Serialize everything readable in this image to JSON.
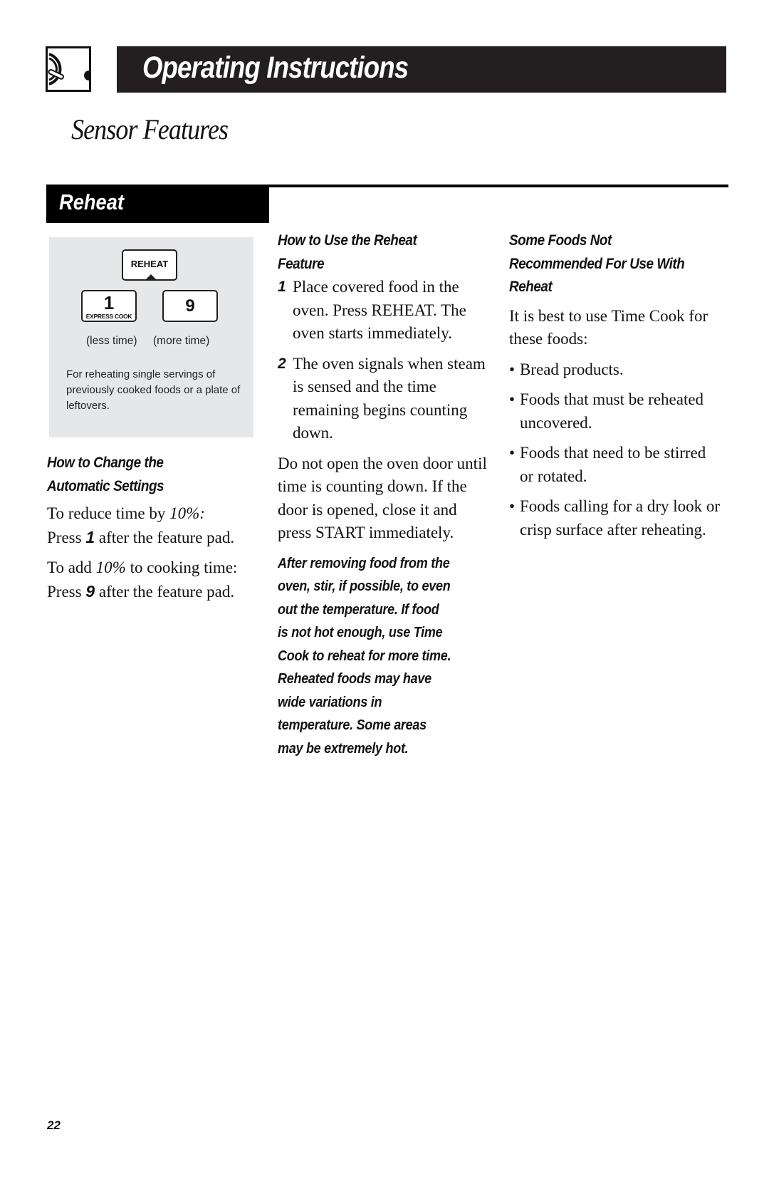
{
  "header": {
    "icon": "microwave-dial-icon",
    "title": "Operating Instructions"
  },
  "section_title": "Sensor Features",
  "subsection": {
    "title": "Reheat"
  },
  "panel": {
    "pads": {
      "reheat": "REHEAT",
      "one_number": "1",
      "one_sub": "EXPRESS COOK",
      "nine": "9"
    },
    "label_less": "(less time)",
    "label_more": "(more time)",
    "description": "For reheating single servings of previously cooked foods or a plate of leftovers."
  },
  "change_settings": {
    "heading_line1": "How to Change the",
    "heading_line2": "Automatic Settings",
    "reduce": {
      "pre": "To reduce time by ",
      "pct": "10%:",
      "line2_pre": "Press ",
      "key": "1",
      "line2_post": " after the feature pad."
    },
    "add": {
      "pre": "To add ",
      "pct": "10%",
      "mid": " to cooking time: Press ",
      "key": "9",
      "post": " after the feature pad."
    }
  },
  "how_to_use": {
    "heading_line1": "How to Use the Reheat",
    "heading_line2": "Feature",
    "steps": [
      {
        "n": "1",
        "text": "Place covered food in the oven. Press REHEAT. The oven starts immediately."
      },
      {
        "n": "2",
        "text": "The oven signals when steam is sensed and the time remaining begins counting down."
      }
    ],
    "note": "Do not open the oven door until time is counting down. If the door is opened, close it and press START immediately.",
    "warning_lines": [
      "After removing food from the",
      "oven, stir, if possible, to even",
      "out the temperature. If food",
      "is not hot enough, use Time",
      "Cook to reheat for more time.",
      "Reheated foods may have",
      "wide variations in",
      "temperature. Some areas",
      "may be extremely hot."
    ]
  },
  "not_recommended": {
    "heading_lines": [
      "Some Foods Not",
      "Recommended For Use With",
      "Reheat"
    ],
    "intro": "It is best to use Time Cook for these foods:",
    "bullets": [
      "Bread products.",
      "Foods that must be reheated uncovered.",
      "Foods that need to be stirred or rotated.",
      "Foods calling for a dry look or crisp surface after reheating."
    ]
  },
  "page_number": "22"
}
